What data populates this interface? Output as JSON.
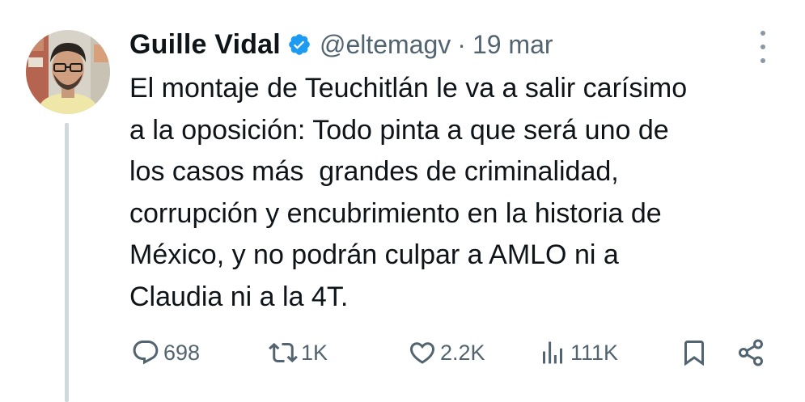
{
  "author": {
    "display_name": "Guille Vidal",
    "handle": "@eltemagv",
    "verified": true,
    "separator": "·",
    "date": "19 mar"
  },
  "icons": {
    "avatar": "avatar-photo",
    "verified": "verified-badge-icon",
    "more": "more-options-icon",
    "reply": "reply-icon",
    "retweet": "retweet-icon",
    "like": "like-icon",
    "views": "views-icon",
    "bookmark": "bookmark-icon",
    "share": "share-icon"
  },
  "tweet": {
    "lines": [
      "El montaje de Teuchitlán le va a salir carísimo",
      "a la oposición: Todo pinta a que será uno de",
      "los casos más  grandes de criminalidad,",
      "corrupción y encubrimiento en la historia de",
      "México, y no podrán culpar a AMLO ni a",
      "Claudia ni a la 4T."
    ]
  },
  "stats": {
    "replies": "698",
    "retweets": "1K",
    "likes": "2.2K",
    "views": "111K"
  },
  "colors": {
    "text": "#0f1419",
    "secondary": "#536471",
    "verified": "#1d9bf0",
    "thread_line": "#cfd9de"
  }
}
